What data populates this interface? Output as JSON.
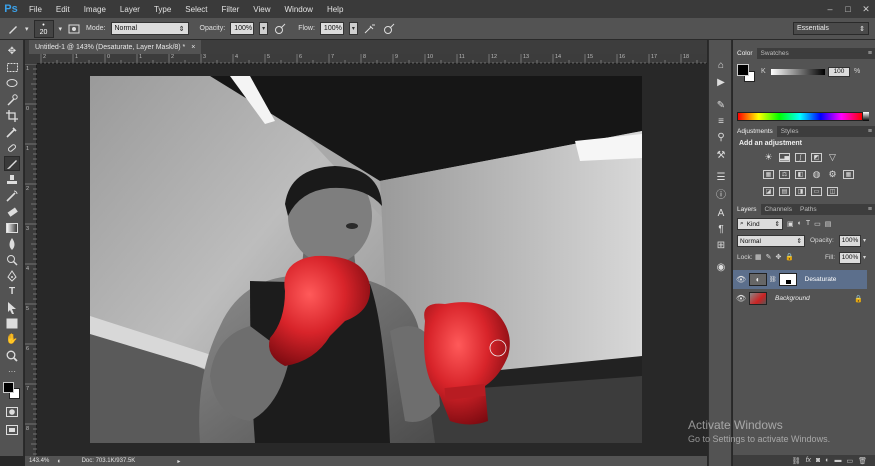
{
  "app": {
    "logo": "Ps"
  },
  "menu": [
    "File",
    "Edit",
    "Image",
    "Layer",
    "Type",
    "Select",
    "Filter",
    "View",
    "Window",
    "Help"
  ],
  "window_controls": {
    "minimize": "–",
    "maximize": "□",
    "close": "✕"
  },
  "options_bar": {
    "brush_size": "20",
    "mode_label": "Mode:",
    "mode_value": "Normal",
    "opacity_label": "Opacity:",
    "opacity_value": "100%",
    "flow_label": "Flow:",
    "flow_value": "100%",
    "workspace": "Essentials"
  },
  "document": {
    "tab_title": "Untitled-1 @ 143% (Desaturate, Layer Mask/8) *",
    "close": "×",
    "ruler_top": [
      "2",
      "1",
      "0",
      "1",
      "2",
      "3",
      "4",
      "5",
      "6",
      "7",
      "8",
      "9",
      "10",
      "11",
      "12",
      "13",
      "14",
      "15",
      "16",
      "17",
      "18"
    ],
    "ruler_left": [
      "1",
      "0",
      "1",
      "2",
      "3",
      "4",
      "5",
      "6",
      "7",
      "8"
    ]
  },
  "status": {
    "zoom": "143.4%",
    "doc_info": "Doc: 703.1K/937.5K"
  },
  "color_panel": {
    "tabs": [
      "Color",
      "Swatches"
    ],
    "channel_label": "K",
    "channel_value": "100",
    "unit": "%",
    "foreground_color": "#000000",
    "background_color": "#ffffff"
  },
  "adjustments_panel": {
    "tabs": [
      "Adjustments",
      "Styles"
    ],
    "heading": "Add an adjustment"
  },
  "layers_panel": {
    "tabs": [
      "Layers",
      "Channels",
      "Paths"
    ],
    "filter_kind": "Kind",
    "blend_mode": "Normal",
    "opacity_label": "Opacity:",
    "opacity_value": "100%",
    "lock_label": "Lock:",
    "fill_label": "Fill:",
    "fill_value": "100%",
    "layers": [
      {
        "name": "Desaturate",
        "selected": true
      },
      {
        "name": "Background",
        "selected": false
      }
    ]
  },
  "footer_icons": [
    "link-icon",
    "fx-icon",
    "mask-icon",
    "adjustment-icon",
    "folder-icon",
    "new-layer-icon",
    "trash-icon"
  ],
  "watermark": {
    "title": "Activate Windows",
    "subtitle": "Go to Settings to activate Windows."
  },
  "colors": {
    "accent": "#3aa0e8",
    "panel_bg": "#535353",
    "dark_bg": "#282828",
    "selected_layer": "#5c6f8c",
    "glove_red": "#d8242a"
  }
}
